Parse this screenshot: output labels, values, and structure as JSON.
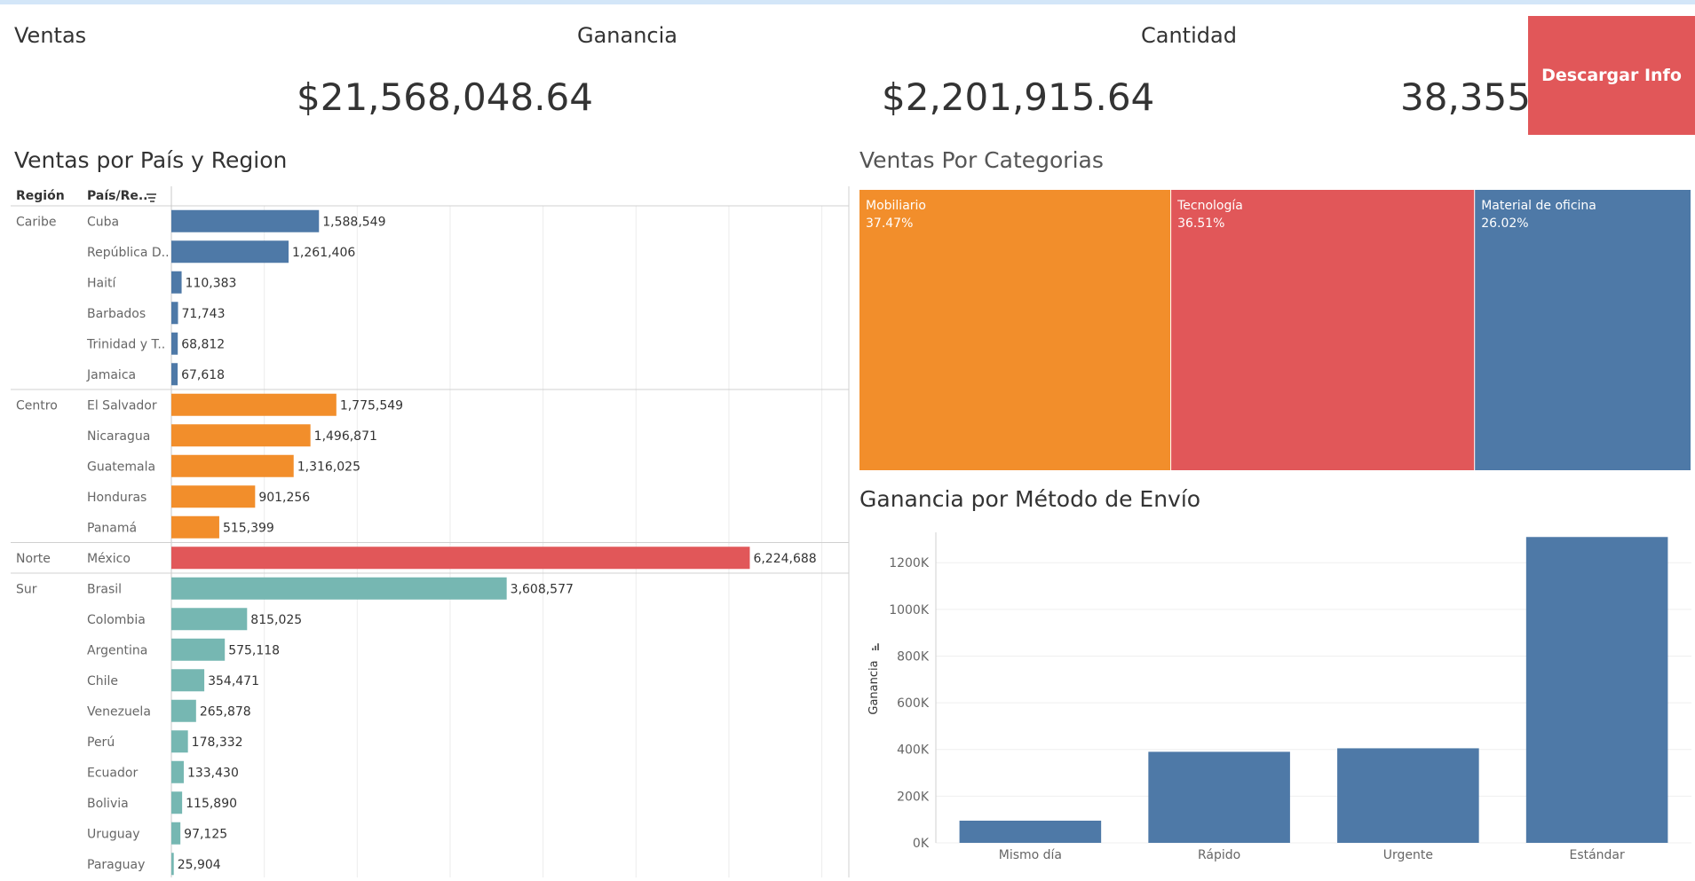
{
  "kpis": {
    "ventas": {
      "title": "Ventas",
      "value": "$21,568,048.64"
    },
    "ganancia": {
      "title": "Ganancia",
      "value": "$2,201,915.64"
    },
    "cantidad": {
      "title": "Cantidad",
      "value": "38,355"
    }
  },
  "download_button": {
    "label": "Descargar Info"
  },
  "colors": {
    "caribe": "#4e79a7",
    "centro": "#f28e2b",
    "norte": "#e15759",
    "sur": "#76b7b2",
    "column": "#4e79a7"
  },
  "icons": {
    "sort": "sort-descending-icon",
    "axis_sort": "bar-sort-icon"
  },
  "chart_data": [
    {
      "type": "bar",
      "orientation": "horizontal",
      "title": "Ventas por País y Region",
      "row_headers": [
        "Región",
        "País/Re.."
      ],
      "groups": [
        {
          "region": "Caribe",
          "color": "#4e79a7",
          "rows": [
            {
              "label": "Cuba",
              "value": 1588549,
              "display": "1,588,549"
            },
            {
              "label": "República D..",
              "value": 1261406,
              "display": "1,261,406"
            },
            {
              "label": "Haití",
              "value": 110383,
              "display": "110,383"
            },
            {
              "label": "Barbados",
              "value": 71743,
              "display": "71,743"
            },
            {
              "label": "Trinidad y T..",
              "value": 68812,
              "display": "68,812"
            },
            {
              "label": "Jamaica",
              "value": 67618,
              "display": "67,618"
            }
          ]
        },
        {
          "region": "Centro",
          "color": "#f28e2b",
          "rows": [
            {
              "label": "El Salvador",
              "value": 1775549,
              "display": "1,775,549"
            },
            {
              "label": "Nicaragua",
              "value": 1496871,
              "display": "1,496,871"
            },
            {
              "label": "Guatemala",
              "value": 1316025,
              "display": "1,316,025"
            },
            {
              "label": "Honduras",
              "value": 901256,
              "display": "901,256"
            },
            {
              "label": "Panamá",
              "value": 515399,
              "display": "515,399"
            }
          ]
        },
        {
          "region": "Norte",
          "color": "#e15759",
          "rows": [
            {
              "label": "México",
              "value": 6224688,
              "display": "6,224,688"
            }
          ]
        },
        {
          "region": "Sur",
          "color": "#76b7b2",
          "rows": [
            {
              "label": "Brasil",
              "value": 3608577,
              "display": "3,608,577"
            },
            {
              "label": "Colombia",
              "value": 815025,
              "display": "815,025"
            },
            {
              "label": "Argentina",
              "value": 575118,
              "display": "575,118"
            },
            {
              "label": "Chile",
              "value": 354471,
              "display": "354,471"
            },
            {
              "label": "Venezuela",
              "value": 265878,
              "display": "265,878"
            },
            {
              "label": "Perú",
              "value": 178332,
              "display": "178,332"
            },
            {
              "label": "Ecuador",
              "value": 133430,
              "display": "133,430"
            },
            {
              "label": "Bolivia",
              "value": 115890,
              "display": "115,890"
            },
            {
              "label": "Uruguay",
              "value": 97125,
              "display": "97,125"
            },
            {
              "label": "Paraguay",
              "value": 25904,
              "display": "25,904"
            }
          ]
        }
      ],
      "xlim": [
        0,
        7300000
      ],
      "grid": true
    },
    {
      "type": "treemap",
      "title": "Ventas Por Categorias",
      "items": [
        {
          "label": "Mobiliario",
          "percent": 37.47,
          "display": "37.47%",
          "color": "#f28e2b"
        },
        {
          "label": "Tecnología",
          "percent": 36.51,
          "display": "36.51%",
          "color": "#e15759"
        },
        {
          "label": "Material de oficina",
          "percent": 26.02,
          "display": "26.02%",
          "color": "#4e79a7"
        }
      ]
    },
    {
      "type": "bar",
      "title": "Ganancia por Método de Envío",
      "ylabel": "Ganancia",
      "categories": [
        "Mismo día",
        "Rápido",
        "Urgente",
        "Estándar"
      ],
      "values": [
        95000,
        390000,
        405000,
        1310000
      ],
      "ylim": [
        0,
        1330000
      ],
      "yticks": [
        0,
        200000,
        400000,
        600000,
        800000,
        1000000,
        1200000
      ],
      "ytick_labels": [
        "0K",
        "200K",
        "400K",
        "600K",
        "800K",
        "1000K",
        "1200K"
      ],
      "color": "#4e79a7",
      "grid": true
    }
  ]
}
